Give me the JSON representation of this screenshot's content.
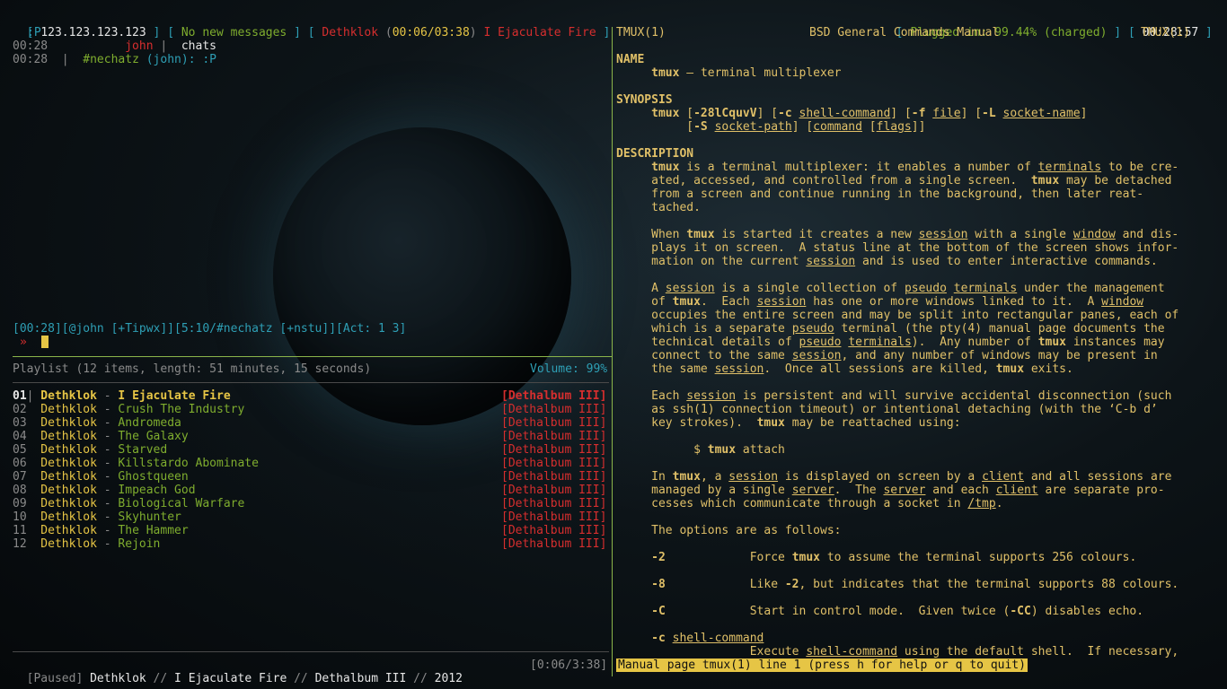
{
  "status": {
    "ip": "123.123.123.123",
    "messages": "No new messages",
    "np_artist": "Dethklok",
    "np_time": "00:06/03:38",
    "np_title": "I Ejaculate Fire",
    "battery": "Plugged in: 99.44% (charged)",
    "clock": "00:28:57"
  },
  "irc": {
    "lines": [
      {
        "time": "",
        "nick": "",
        "text": ":P"
      },
      {
        "time": "00:28",
        "nick": "john",
        "text": "chats"
      },
      {
        "time": "00:28",
        "nick": "#nechatz",
        "text": "(john): :P"
      }
    ],
    "statusline": "[00:28][@john [+Tipwx]][5:10/#nechatz [+nstu]][Act: 1 3]",
    "prompt": "»"
  },
  "playlist": {
    "header": "Playlist (12 items, length: 51 minutes, 15 seconds)",
    "volume": "Volume: 99%",
    "tracks": [
      {
        "num": "01",
        "artist": "Dethklok",
        "title": "I Ejaculate Fire",
        "album": "[Dethalbum III]"
      },
      {
        "num": "02",
        "artist": "Dethklok",
        "title": "Crush The Industry",
        "album": "[Dethalbum III]"
      },
      {
        "num": "03",
        "artist": "Dethklok",
        "title": "Andromeda",
        "album": "[Dethalbum III]"
      },
      {
        "num": "04",
        "artist": "Dethklok",
        "title": "The Galaxy",
        "album": "[Dethalbum III]"
      },
      {
        "num": "05",
        "artist": "Dethklok",
        "title": "Starved",
        "album": "[Dethalbum III]"
      },
      {
        "num": "06",
        "artist": "Dethklok",
        "title": "Killstardo Abominate",
        "album": "[Dethalbum III]"
      },
      {
        "num": "07",
        "artist": "Dethklok",
        "title": "Ghostqueen",
        "album": "[Dethalbum III]"
      },
      {
        "num": "08",
        "artist": "Dethklok",
        "title": "Impeach God",
        "album": "[Dethalbum III]"
      },
      {
        "num": "09",
        "artist": "Dethklok",
        "title": "Biological Warfare",
        "album": "[Dethalbum III]"
      },
      {
        "num": "10",
        "artist": "Dethklok",
        "title": "Skyhunter",
        "album": "[Dethalbum III]"
      },
      {
        "num": "11",
        "artist": "Dethklok",
        "title": "The Hammer",
        "album": "[Dethalbum III]"
      },
      {
        "num": "12",
        "artist": "Dethklok",
        "title": "Rejoin",
        "album": "[Dethalbum III]"
      }
    ],
    "footer": {
      "state": "[Paused]",
      "artist": "Dethklok",
      "title": "I Ejaculate Fire",
      "album": "Dethalbum III",
      "year": "2012",
      "time": "[0:06/3:38]"
    }
  },
  "man": {
    "header_left": "TMUX(1)",
    "header_center": "BSD General Commands Manual",
    "header_right": "TMUX(1)",
    "lines": [
      "NAME",
      "     tmux — terminal multiplexer",
      "",
      "SYNOPSIS",
      "     tmux [-28lCquvV] [-c shell-command] [-f file] [-L socket-name]",
      "          [-S socket-path] [command [flags]]",
      "",
      "DESCRIPTION",
      "     tmux is a terminal multiplexer: it enables a number of terminals to be cre-",
      "     ated, accessed, and controlled from a single screen.  tmux may be detached",
      "     from a screen and continue running in the background, then later reat-",
      "     tached.",
      "",
      "     When tmux is started it creates a new session with a single window and dis-",
      "     plays it on screen.  A status line at the bottom of the screen shows infor-",
      "     mation on the current session and is used to enter interactive commands.",
      "",
      "     A session is a single collection of pseudo terminals under the management",
      "     of tmux.  Each session has one or more windows linked to it.  A window",
      "     occupies the entire screen and may be split into rectangular panes, each of",
      "     which is a separate pseudo terminal (the pty(4) manual page documents the",
      "     technical details of pseudo terminals).  Any number of tmux instances may",
      "     connect to the same session, and any number of windows may be present in",
      "     the same session.  Once all sessions are killed, tmux exits.",
      "",
      "     Each session is persistent and will survive accidental disconnection (such",
      "     as ssh(1) connection timeout) or intentional detaching (with the ‘C-b d’",
      "     key strokes).  tmux may be reattached using:",
      "",
      "           $ tmux attach",
      "",
      "     In tmux, a session is displayed on screen by a client and all sessions are",
      "     managed by a single server.  The server and each client are separate pro-",
      "     cesses which communicate through a socket in /tmp.",
      "",
      "     The options are as follows:",
      "",
      "     -2            Force tmux to assume the terminal supports 256 colours.",
      "",
      "     -8            Like -2, but indicates that the terminal supports 88 colours.",
      "",
      "     -C            Start in control mode.  Given twice (-CC) disables echo.",
      "",
      "     -c shell-command",
      "                   Execute shell-command using the default shell.  If necessary,"
    ],
    "prompt": "Manual page tmux(1) line 1 (press h for help or q to quit)"
  }
}
